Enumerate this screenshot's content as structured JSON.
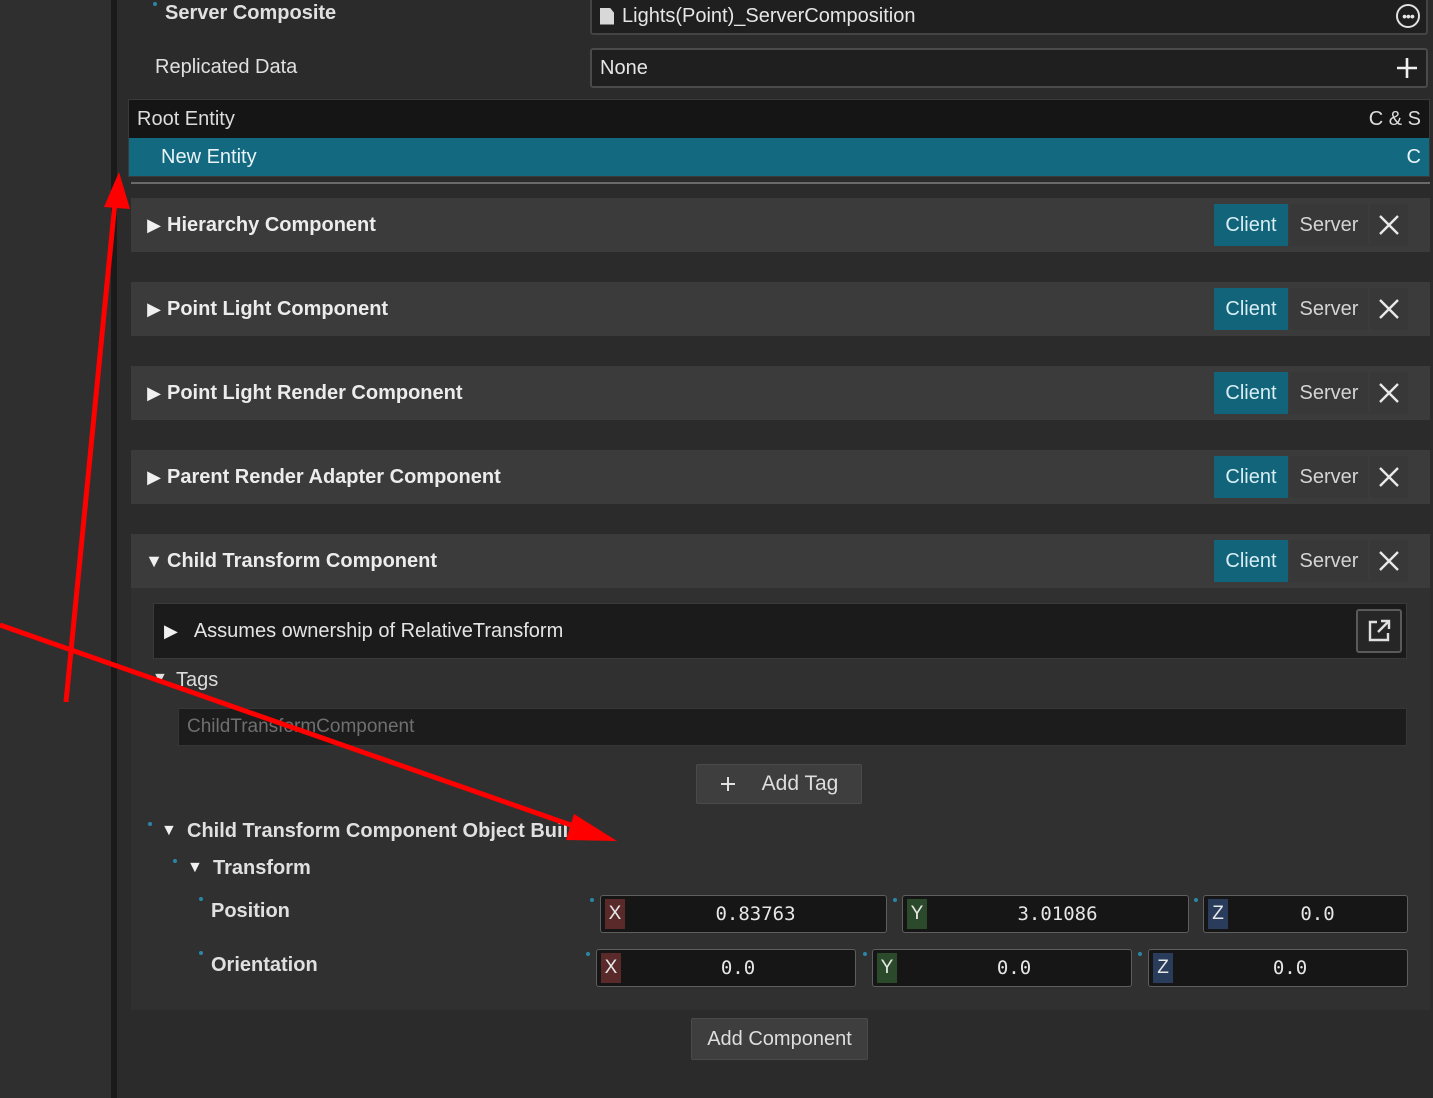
{
  "properties": {
    "server_composite_label": "Server Composite",
    "server_composite_value": "Lights(Point)_ServerComposition",
    "replicated_data_label": "Replicated Data",
    "replicated_data_value": "None"
  },
  "entities": [
    {
      "name": "Root Entity",
      "tag": "C & S"
    },
    {
      "name": "New Entity",
      "tag": "C"
    }
  ],
  "component_buttons": {
    "client": "Client",
    "server": "Server"
  },
  "components": [
    {
      "title": "Hierarchy Component",
      "expanded": false
    },
    {
      "title": "Point Light Component",
      "expanded": false
    },
    {
      "title": "Point Light Render Component",
      "expanded": false
    },
    {
      "title": "Parent Render Adapter Component",
      "expanded": false
    },
    {
      "title": "Child Transform Component",
      "expanded": true
    }
  ],
  "child_transform": {
    "ownership_text": "Assumes ownership of RelativeTransform",
    "tags_label": "Tags",
    "tag_value": "ChildTransformComponent",
    "add_tag_label": "Add Tag",
    "object_builder_label": "Child Transform Component Object Builder",
    "transform_label": "Transform",
    "position_label": "Position",
    "orientation_label": "Orientation",
    "axis_labels": [
      "X",
      "Y",
      "Z"
    ],
    "position": [
      "0.83763",
      "3.01086",
      "0.0"
    ],
    "orientation": [
      "0.0",
      "0.0",
      "0.0"
    ]
  },
  "add_component_label": "Add Component",
  "annotation_color": "#ff0000",
  "colors": {
    "accent": "#11647a",
    "selection": "#136980"
  }
}
